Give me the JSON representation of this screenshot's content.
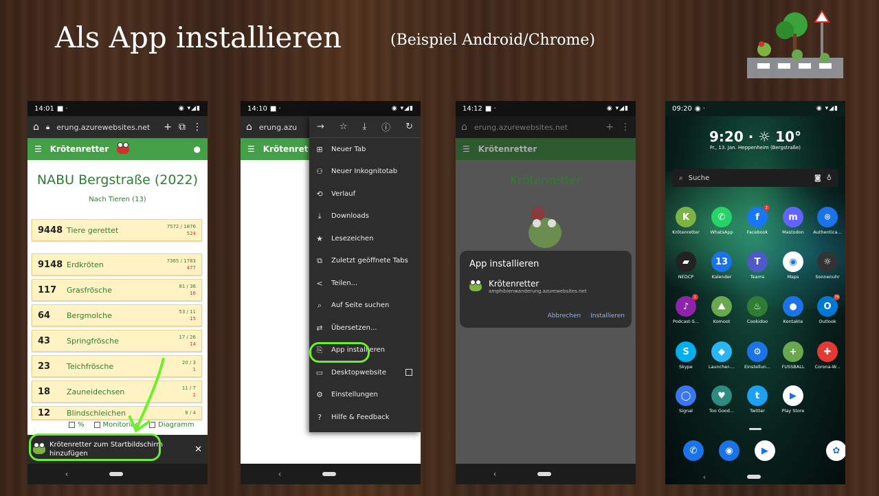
{
  "slide": {
    "title": "Als App installieren",
    "subtitle": "(Beispiel Android/Chrome)"
  },
  "phone1": {
    "time": "14:01",
    "status_icons": "◉ ▾◢▮",
    "url": "erung.azurewebsites.net",
    "app_title": "Krötenretter",
    "page_title": "NABU Bergstraße (2022)",
    "section": "Nach Tieren (13)",
    "rows": [
      {
        "count": "9448",
        "name": "Tiere gerettet",
        "a": "7572 / 1876",
        "b": "524"
      },
      {
        "count": "9148",
        "name": "Erdkröten",
        "a": "7365 / 1783",
        "b": "477"
      },
      {
        "count": "117",
        "name": "Grasfrösche",
        "a": "81 / 36",
        "b": "16"
      },
      {
        "count": "64",
        "name": "Bergmolche",
        "a": "53 / 11",
        "b": "15"
      },
      {
        "count": "43",
        "name": "Springfrösche",
        "a": "17 / 26",
        "b": "14"
      },
      {
        "count": "23",
        "name": "Teichfrösche",
        "a": "20 / 3",
        "b": "1"
      },
      {
        "count": "18",
        "name": "Zauneidechsen",
        "a": "11 / 7",
        "b": "1"
      },
      {
        "count": "12",
        "name": "Blindschleichen",
        "a": "8 / 4",
        "b": ""
      }
    ],
    "checks": [
      "%",
      "Monitoring",
      "Diagramm"
    ],
    "banner_text": "Krötenretter zum Startbildschirm hinzufügen",
    "close": "✕"
  },
  "phone2": {
    "time": "14:10",
    "status_icons": "◉ ▾◢▮",
    "url": "erung.azu",
    "app_title": "Krötenret",
    "menu": [
      {
        "icon": "⊞",
        "label": "Neuer Tab"
      },
      {
        "icon": "⚇",
        "label": "Neuer Inkognitotab"
      },
      {
        "icon": "⟲",
        "label": "Verlauf"
      },
      {
        "icon": "⤓",
        "label": "Downloads"
      },
      {
        "icon": "★",
        "label": "Lesezeichen"
      },
      {
        "icon": "⧉",
        "label": "Zuletzt geöffnete Tabs"
      },
      {
        "icon": "<",
        "label": "Teilen..."
      },
      {
        "icon": "⌕",
        "label": "Auf Seite suchen"
      },
      {
        "icon": "⇄",
        "label": "Übersetzen..."
      },
      {
        "icon": "⎘",
        "label": "App installieren"
      },
      {
        "icon": "▭",
        "label": "Desktopwebsite"
      },
      {
        "icon": "⚙",
        "label": "Einstellungen"
      },
      {
        "icon": "?",
        "label": "Hilfe & Feedback"
      }
    ]
  },
  "phone3": {
    "time": "14:12",
    "status_icons": "◉ ▾◢▮",
    "url": "erung.azurewebsites.net",
    "app_title": "Krötenretter",
    "page_title": "Krötenretter",
    "dialog_title": "App installieren",
    "app_name": "Krötenretter",
    "app_url": "amphibienwanderung.azurewebsites.net",
    "cancel": "Abbrechen",
    "install": "Installieren"
  },
  "phone4": {
    "time": "09:20",
    "status_icons": "◉ ▾◢▮",
    "clock": "9:20 · ☼ 10°",
    "date": "Fr., 13. Jan. Heppenheim (Bergstraße)",
    "search_label": "Suche",
    "apps": [
      {
        "label": "Krötenretter",
        "icon": "K",
        "color": "#7cb342",
        "badge": ""
      },
      {
        "label": "WhatsApp",
        "icon": "✆",
        "color": "#25d366",
        "badge": ""
      },
      {
        "label": "Facebook",
        "icon": "f",
        "color": "#1877f2",
        "badge": "2"
      },
      {
        "label": "Mastodon",
        "icon": "m",
        "color": "#6364ff",
        "badge": ""
      },
      {
        "label": "Authentica...",
        "icon": "⌾",
        "color": "#1a73e8",
        "badge": ""
      },
      {
        "label": "NEDCP",
        "icon": "▰",
        "color": "#222",
        "badge": ""
      },
      {
        "label": "Kalender",
        "icon": "13",
        "color": "#1a73e8",
        "badge": ""
      },
      {
        "label": "Teams",
        "icon": "T",
        "color": "#5059c9",
        "badge": ""
      },
      {
        "label": "Maps",
        "icon": "◉",
        "color": "#fff",
        "badge": ""
      },
      {
        "label": "Sonnenuhr",
        "icon": "☼",
        "color": "#333",
        "badge": ""
      },
      {
        "label": "Podcast-S...",
        "icon": "♪",
        "color": "#8e24aa",
        "badge": "1"
      },
      {
        "label": "Komoot",
        "icon": "⛰",
        "color": "#6aa84f",
        "badge": ""
      },
      {
        "label": "Cookidoo",
        "icon": "♨",
        "color": "#2e7d32",
        "badge": ""
      },
      {
        "label": "Kontakte",
        "icon": "●",
        "color": "#1a73e8",
        "badge": ""
      },
      {
        "label": "Outlook",
        "icon": "O",
        "color": "#0078d4",
        "badge": "70"
      },
      {
        "label": "Skype",
        "icon": "S",
        "color": "#00aff0",
        "badge": ""
      },
      {
        "label": "Launcher-...",
        "icon": "◆",
        "color": "#29b6f6",
        "badge": ""
      },
      {
        "label": "Einstellun...",
        "icon": "⚙",
        "color": "#1a73e8",
        "badge": ""
      },
      {
        "label": "FUSSBALL",
        "icon": "+",
        "color": "#6aa84f",
        "badge": ""
      },
      {
        "label": "Corona-W...",
        "icon": "✚",
        "color": "#e53935",
        "badge": ""
      },
      {
        "label": "Signal",
        "icon": "◯",
        "color": "#3a76f0",
        "badge": ""
      },
      {
        "label": "Too Good...",
        "icon": "♥",
        "color": "#2e8b80",
        "badge": ""
      },
      {
        "label": "Twitter",
        "icon": "t",
        "color": "#1da1f2",
        "badge": ""
      },
      {
        "label": "Play Store",
        "icon": "▶",
        "color": "#fff",
        "badge": ""
      }
    ],
    "dock": [
      {
        "icon": "✆",
        "color": "#1a73e8"
      },
      {
        "icon": "◉",
        "color": "#1a73e8"
      },
      {
        "icon": "▶",
        "color": "#fff"
      },
      {
        "icon": "✿",
        "color": "#fff"
      }
    ]
  }
}
